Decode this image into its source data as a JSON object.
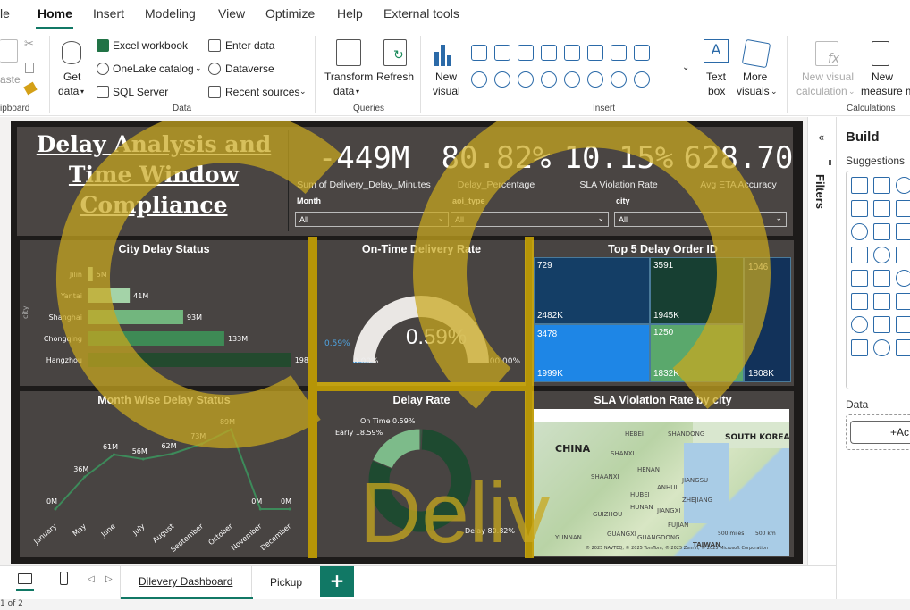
{
  "menu": {
    "items": [
      "le",
      "Home",
      "Insert",
      "Modeling",
      "View",
      "Optimize",
      "Help",
      "External tools"
    ],
    "active": "Home"
  },
  "ribbon": {
    "clipboard": {
      "paste_label": "aste",
      "group_label": "ipboard"
    },
    "data": {
      "get_data": [
        "Get",
        "data"
      ],
      "excel": "Excel workbook",
      "onelake": "OneLake catalog",
      "sql": "SQL Server",
      "enter_data": "Enter data",
      "dataverse": "Dataverse",
      "recent": "Recent sources",
      "group_label": "Data"
    },
    "queries": {
      "transform": [
        "Transform",
        "data"
      ],
      "refresh": "Refresh",
      "group_label": "Queries"
    },
    "insert": {
      "new_visual": [
        "New",
        "visual"
      ],
      "text_box": [
        "Text",
        "box"
      ],
      "more_visuals": [
        "More",
        "visuals"
      ],
      "group_label": "Insert"
    },
    "calculations": {
      "new_visual_calc": [
        "New visual",
        "calculation"
      ],
      "new_measure": [
        "New",
        "measure m"
      ],
      "group_label": "Calculations"
    }
  },
  "report": {
    "title_lines": [
      "Delay Analysis and",
      "Time Window",
      "Compliance"
    ],
    "kpis": [
      {
        "value": "-449M",
        "label": "Sum of Delivery_Delay_Minutes"
      },
      {
        "value": "80.82%",
        "label": "Delay_Percentage"
      },
      {
        "value": "10.15%",
        "label": "SLA Violation Rate"
      },
      {
        "value": "628.70",
        "label": "Avg ETA Accuracy"
      }
    ],
    "slicers": [
      {
        "label": "Month",
        "value": "All"
      },
      {
        "label": "aoi_type",
        "value": "All"
      },
      {
        "label": "city",
        "value": "All"
      }
    ],
    "watermark_text": "Deliv",
    "city_delay": {
      "title": "City Delay Status",
      "axis_label": "city",
      "bar_colors": [
        "#c9e3c2",
        "#a4d3a8",
        "#72b67e",
        "#3e8a55",
        "#234a2e"
      ]
    },
    "ontime": {
      "title": "On-Time Delivery Rate",
      "value": "0.59%",
      "target": "0.59%",
      "min": "0.00%",
      "max": "100.00%",
      "fraction": 0.0059
    },
    "treemap": {
      "title": "Top 5 Delay Order ID",
      "cells": [
        {
          "id": "729",
          "value": "2482K",
          "color": "#143e66"
        },
        {
          "id": "3591",
          "value": "1945K",
          "color": "#173f32"
        },
        {
          "id": "1046",
          "value": "1808K",
          "color": "#12325a"
        },
        {
          "id": "3478",
          "value": "1999K",
          "color": "#1e86e6"
        },
        {
          "id": "1250",
          "value": "1832K",
          "color": "#5aa86c"
        }
      ]
    },
    "month": {
      "title": "Month Wise Delay Status"
    },
    "donut": {
      "title": "Delay Rate",
      "labels": [
        "On Time 0.59%",
        "Early 18.59%",
        "Delay 80.82%"
      ]
    },
    "map": {
      "title": "SLA Violation Rate by city",
      "labels": [
        "CHINA",
        "SOUTH KOREA",
        "HEBEI",
        "SHANDONG",
        "SHANXI",
        "HENAN",
        "JIANGSU",
        "SHAANXI",
        "ANHUI",
        "HUBEI",
        "ZHEJIANG",
        "HUNAN",
        "JIANGXI",
        "GUIZHOU",
        "FUJIAN",
        "GUANGXI",
        "GUANGDONG",
        "YUNNAN",
        "TAIWAN"
      ],
      "scale_labels": [
        "500 miles",
        "500 km"
      ],
      "credit": "© 2025 NAVTEQ, © 2025 TomTom, © 2025 Zenrin, © 2025 Microsoft Corporation"
    }
  },
  "tabs": [
    "Dilevery Dashboard",
    "Pickup"
  ],
  "add_tab": "+",
  "status": "1 of 2",
  "filters_label": "Filters",
  "build": {
    "title": "Build",
    "suggestions": "Suggestions",
    "data": "Data",
    "add": "+Ac"
  },
  "chart_data": [
    {
      "type": "bar",
      "title": "City Delay Status",
      "ylabel": "city",
      "categories": [
        "Jilin",
        "Yantai",
        "Shanghai",
        "Chongqing",
        "Hangzhou"
      ],
      "values": [
        5,
        41,
        93,
        133,
        198
      ],
      "value_labels": [
        "5M",
        "41M",
        "93M",
        "133M",
        "198M"
      ],
      "orientation": "horizontal"
    },
    {
      "type": "line",
      "title": "Month Wise Delay Status",
      "categories": [
        "January",
        "May",
        "June",
        "July",
        "August",
        "September",
        "October",
        "November",
        "December"
      ],
      "values": [
        0,
        36,
        61,
        56,
        62,
        73,
        89,
        0,
        0
      ],
      "value_labels": [
        "0M",
        "36M",
        "61M",
        "56M",
        "62M",
        "73M",
        "89M",
        "0M",
        "0M"
      ]
    },
    {
      "type": "pie",
      "title": "Delay Rate",
      "categories": [
        "On Time",
        "Early",
        "Delay"
      ],
      "values": [
        0.59,
        18.59,
        80.82
      ],
      "colors": [
        "#2e6b47",
        "#7dbb8a",
        "#1e4a30"
      ]
    }
  ]
}
